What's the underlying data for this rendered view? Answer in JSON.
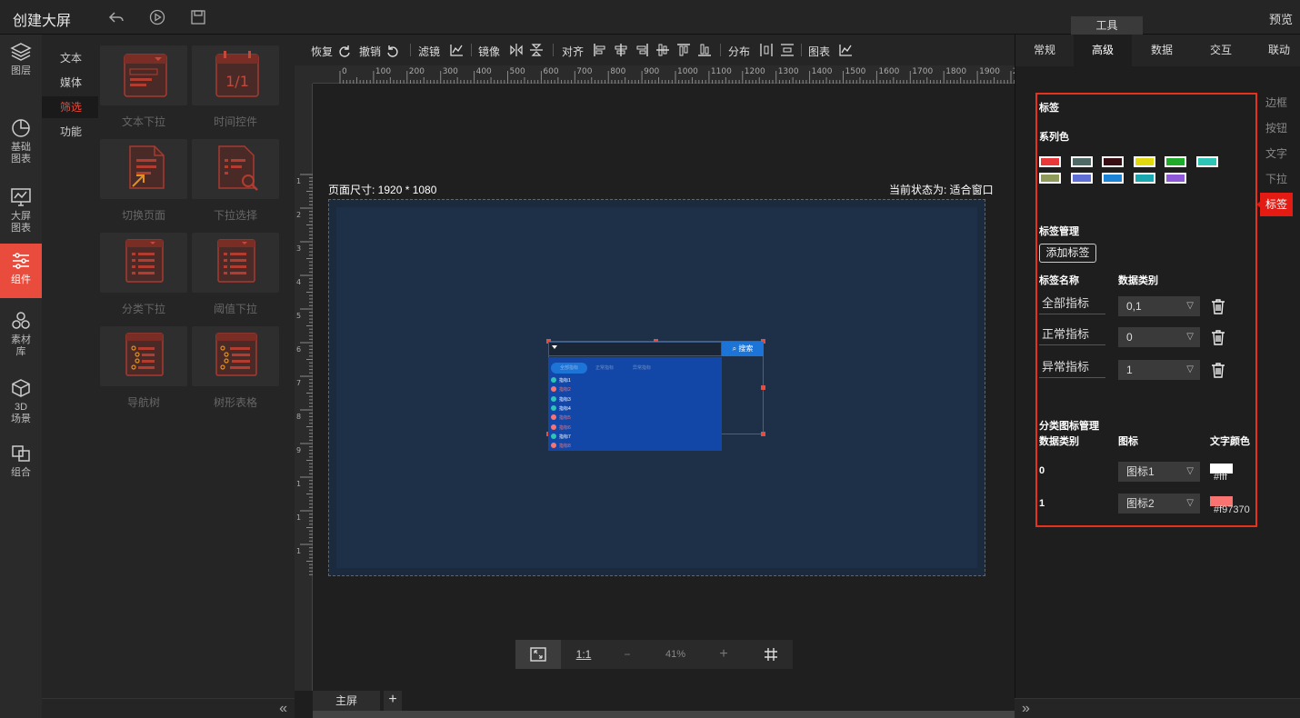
{
  "header": {
    "title": "创建大屏",
    "preview_label": "预览",
    "tools_label": "工具"
  },
  "leftnav": [
    {
      "label1": "图层",
      "label2": "",
      "icon": "layers-icon"
    },
    {
      "label1": "基础",
      "label2": "图表",
      "icon": "pie-chart-icon"
    },
    {
      "label1": "大屏",
      "label2": "图表",
      "icon": "monitor-chart-icon"
    },
    {
      "label1": "组件",
      "label2": "",
      "icon": "sliders-icon"
    },
    {
      "label1": "素材",
      "label2": "库",
      "icon": "material-icon"
    },
    {
      "label1": "3D",
      "label2": "场景",
      "icon": "cube-icon"
    },
    {
      "label1": "组合",
      "label2": "",
      "icon": "group-icon"
    }
  ],
  "categories": [
    "文本",
    "媒体",
    "筛选",
    "功能"
  ],
  "components": [
    "文本下拉",
    "时间控件",
    "切换页面",
    "下拉选择",
    "分类下拉",
    "阈值下拉",
    "导航树",
    "树形表格"
  ],
  "toolbar": {
    "redo": "恢复",
    "undo": "撤销",
    "filter": "滤镜",
    "mirror": "镜像",
    "align": "对齐",
    "distribute": "分布",
    "chart": "图表"
  },
  "ruler_ticks": [
    "0",
    "100",
    "200",
    "300",
    "400",
    "500",
    "600",
    "700",
    "800",
    "900",
    "1000",
    "1100",
    "1200",
    "1300",
    "1400",
    "1500",
    "1600",
    "1700",
    "1800",
    "1900",
    "20"
  ],
  "ruler_v_ticks": [
    "1",
    "2",
    "3",
    "4",
    "5",
    "6",
    "7",
    "8",
    "9",
    "1",
    "1",
    "1"
  ],
  "canvas": {
    "page_size": "页面尺寸: 1920 * 1080",
    "current_state": "当前状态为: 适合窗口"
  },
  "widget": {
    "search_label": "搜索",
    "tabs": [
      "全部指标",
      "正常指标",
      "异常指标"
    ],
    "rows": [
      {
        "text": "指标1",
        "color": "#2ec4b6"
      },
      {
        "text": "指标2",
        "color": "#f97370"
      },
      {
        "text": "指标3",
        "color": "#2ec4b6"
      },
      {
        "text": "指标4",
        "color": "#2ec4b6"
      },
      {
        "text": "指标5",
        "color": "#f97370"
      },
      {
        "text": "指标6",
        "color": "#f97370"
      },
      {
        "text": "指标7",
        "color": "#2ec4b6"
      },
      {
        "text": "指标8",
        "color": "#f97370"
      }
    ]
  },
  "zoom": {
    "fit": "fit-screen-icon",
    "one_to_one": "1:1",
    "minus": "−",
    "value": "41%",
    "plus": "+",
    "grid": "grid-icon"
  },
  "bottom_tabs": {
    "main": "主屏",
    "add": "+"
  },
  "right_tabs": [
    "常规",
    "高级",
    "数据",
    "交互",
    "联动"
  ],
  "side_tabs": [
    "边框",
    "按钮",
    "文字",
    "下拉",
    "标签"
  ],
  "tag_panel": {
    "section_title": "标签",
    "series_color_label": "系列色",
    "series_colors": [
      "#e8383a",
      "#4f6a66",
      "#3a0d12",
      "#e2d80f",
      "#1faa2c",
      "#2ec4b6",
      "#8e9b5a",
      "#5f6fd6",
      "#1b84d6",
      "#1aa7b0",
      "#8f58d8"
    ],
    "tag_mgmt_label": "标签管理",
    "add_tag_button": "添加标签",
    "col_tag_name": "标签名称",
    "col_data_type": "数据类别",
    "tags": [
      {
        "name": "全部指标",
        "value": "0,1"
      },
      {
        "name": "正常指标",
        "value": "0"
      },
      {
        "name": "异常指标",
        "value": "1"
      }
    ],
    "icon_mgmt_label": "分类图标管理",
    "col_data_type2": "数据类别",
    "col_icon": "图标",
    "col_text_color": "文字颜色",
    "icon_rows": [
      {
        "type": "0",
        "icon": "图标1",
        "color_hex": "#fff",
        "color": "#ffffff"
      },
      {
        "type": "1",
        "icon": "图标2",
        "color_hex": "#f97370",
        "color": "#f97370"
      }
    ]
  }
}
